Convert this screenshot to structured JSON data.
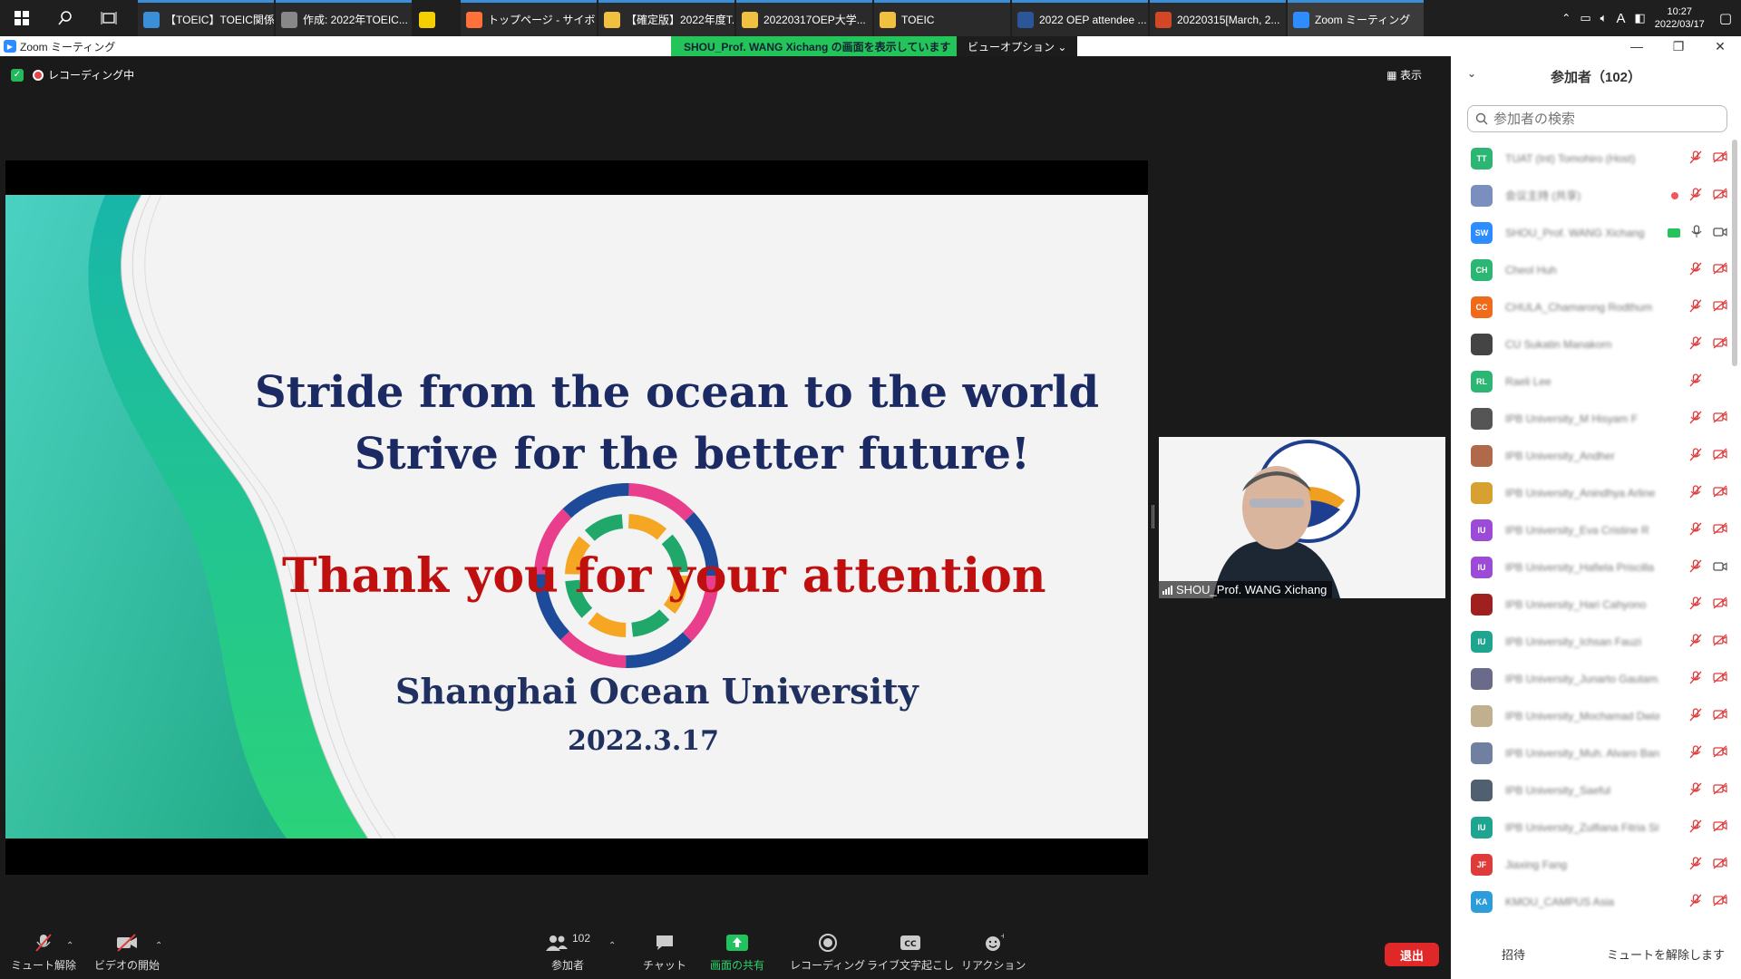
{
  "taskbar": {
    "apps": [
      {
        "label": "【TOEIC】TOEIC関係 ...",
        "icon": "onedrive-icon",
        "color": "#3a8fd8"
      },
      {
        "label": "作成: 2022年TOEIC...",
        "icon": "pen-icon",
        "color": "#888888"
      },
      {
        "label": "",
        "icon": "sticky-notes-icon",
        "color": "#f5d000"
      },
      {
        "label": "トップページ - サイボウ...",
        "icon": "firefox-icon",
        "color": "#ff7139"
      },
      {
        "label": "【確定版】2022年度T...",
        "icon": "folder-icon",
        "color": "#f0c040"
      },
      {
        "label": "20220317OEP大学...",
        "icon": "folder-icon",
        "color": "#f0c040"
      },
      {
        "label": "TOEIC",
        "icon": "folder-icon",
        "color": "#f0c040"
      },
      {
        "label": "2022 OEP attendee ...",
        "icon": "word-icon",
        "color": "#2b579a"
      },
      {
        "label": "20220315[March, 2...",
        "icon": "powerpoint-icon",
        "color": "#d24726"
      },
      {
        "label": "Zoom ミーティング",
        "icon": "zoom-icon",
        "color": "#2d8cff"
      }
    ],
    "clock_time": "10:27",
    "clock_date": "2022/03/17",
    "ime": "A"
  },
  "titlebar": {
    "title": "Zoom ミーティング",
    "share_banner": "SHOU_Prof. WANG Xichang の画面を表示しています",
    "view_options": "ビューオプション ⌄"
  },
  "meeting": {
    "recording_label": "レコーディング中",
    "view_label": "表示"
  },
  "slide": {
    "line1": "Stride from the ocean to the world",
    "line2": "Strive for the better future!",
    "line3": "Thank you for your attention",
    "line4": "Shanghai Ocean University",
    "line5": "2022.3.17"
  },
  "speaker": {
    "name": "SHOU_Prof. WANG Xichang"
  },
  "toolbar": {
    "unmute": "ミュート解除",
    "start_video": "ビデオの開始",
    "participants": "参加者",
    "participants_count": "102",
    "chat": "チャット",
    "share": "画面の共有",
    "recording": "レコーディング",
    "captions": "ライブ文字起こし",
    "reactions": "リアクション",
    "leave": "退出"
  },
  "panel": {
    "title": "参加者（102）",
    "search_placeholder": "参加者の検索",
    "invite": "招待",
    "unmute_all": "ミュートを解除します",
    "participants": [
      {
        "name": "TUAT (Int) Tomohiro (Host)",
        "initials": "TT",
        "color": "#2bb673",
        "mic": "off",
        "cam": "off"
      },
      {
        "name": "会议主持 (共享)",
        "initials": "",
        "color": "#7a8fbf",
        "mic": "off",
        "cam": "off",
        "raise": true
      },
      {
        "name": "SHOU_Prof. WANG Xichang",
        "initials": "SW",
        "color": "#2d8cff",
        "mic": "on",
        "cam": "on",
        "talk": true
      },
      {
        "name": "Cheol Huh",
        "initials": "CH",
        "color": "#2bb673",
        "mic": "off",
        "cam": "off"
      },
      {
        "name": "CHULA_Chamarong Rodthum",
        "initials": "CC",
        "color": "#f06a1c",
        "mic": "off",
        "cam": "off"
      },
      {
        "name": "CU Sukatin Manakorn",
        "initials": "",
        "color": "#444444",
        "mic": "off",
        "cam": "off"
      },
      {
        "name": "Raeli Lee",
        "initials": "RL",
        "color": "#2bb673",
        "mic": "off",
        "cam": "none"
      },
      {
        "name": "IPB University_M Hisyam F",
        "initials": "",
        "color": "#555555",
        "mic": "off",
        "cam": "off"
      },
      {
        "name": "IPB University_Andher",
        "initials": "",
        "color": "#b06a4a",
        "mic": "off",
        "cam": "off"
      },
      {
        "name": "IPB University_Anindhya Arline",
        "initials": "",
        "color": "#d8a030",
        "mic": "off",
        "cam": "off"
      },
      {
        "name": "IPB University_Eva Cristine R",
        "initials": "IU",
        "color": "#9b4bd6",
        "mic": "off",
        "cam": "off"
      },
      {
        "name": "IPB University_Hafiela Priscilla",
        "initials": "IU",
        "color": "#9b4bd6",
        "mic": "off",
        "cam": "on"
      },
      {
        "name": "IPB University_Hari Cahyono",
        "initials": "",
        "color": "#a02020",
        "mic": "off",
        "cam": "off"
      },
      {
        "name": "IPB University_Ichsan Fauzi",
        "initials": "IU",
        "color": "#1fa58f",
        "mic": "off",
        "cam": "off"
      },
      {
        "name": "IPB University_Junarto Gautam...",
        "initials": "",
        "color": "#6a6a8a",
        "mic": "off",
        "cam": "off"
      },
      {
        "name": "IPB University_Mochamad Dwia...",
        "initials": "",
        "color": "#c0b090",
        "mic": "off",
        "cam": "off"
      },
      {
        "name": "IPB University_Muh. Alvaro Bard...",
        "initials": "",
        "color": "#7080a0",
        "mic": "off",
        "cam": "off"
      },
      {
        "name": "IPB University_Saeful",
        "initials": "",
        "color": "#506070",
        "mic": "off",
        "cam": "off"
      },
      {
        "name": "IPB University_Zulfiana Fitria Sifa",
        "initials": "IU",
        "color": "#1fa58f",
        "mic": "off",
        "cam": "off"
      },
      {
        "name": "Jiaxing Fang",
        "initials": "JF",
        "color": "#e03b3b",
        "mic": "off",
        "cam": "off"
      },
      {
        "name": "KMOU_CAMPUS Asia",
        "initials": "KA",
        "color": "#2d9cdb",
        "mic": "off",
        "cam": "off"
      }
    ]
  }
}
